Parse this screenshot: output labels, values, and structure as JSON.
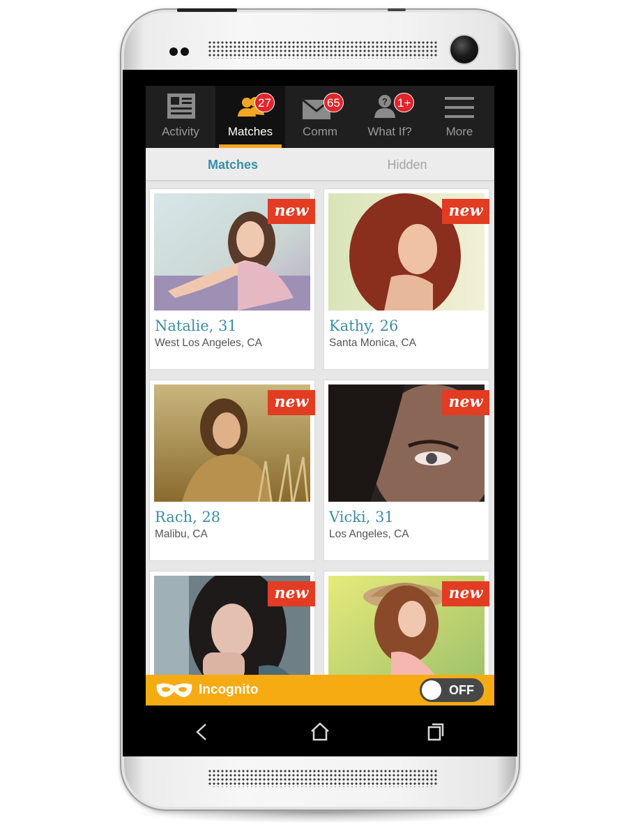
{
  "tabs": [
    {
      "label": "Activity",
      "icon": "newspaper-icon",
      "badge": ""
    },
    {
      "label": "Matches",
      "icon": "people-icon",
      "badge": "27"
    },
    {
      "label": "Comm",
      "icon": "envelope-icon",
      "badge": "65"
    },
    {
      "label": "What If?",
      "icon": "question-person-icon",
      "badge": "1+"
    },
    {
      "label": "More",
      "icon": "menu-icon",
      "badge": ""
    }
  ],
  "subtabs": [
    {
      "label": "Matches"
    },
    {
      "label": "Hidden"
    }
  ],
  "cards": [
    {
      "name": "Natalie, 31",
      "location": "West Los Angeles, CA",
      "tag": "new"
    },
    {
      "name": "Kathy, 26",
      "location": "Santa Monica, CA",
      "tag": "new"
    },
    {
      "name": "Rach, 28",
      "location": "Malibu, CA",
      "tag": "new"
    },
    {
      "name": "Vicki, 31",
      "location": "Los Angeles, CA",
      "tag": "new"
    },
    {
      "name": "",
      "location": "",
      "tag": "new"
    },
    {
      "name": "",
      "location": "",
      "tag": "new"
    }
  ],
  "incognito": {
    "label": "Incognito",
    "toggle": "OFF"
  },
  "colors": {
    "accent": "#f5a623",
    "badge": "#e0262b",
    "new_tag": "#e23c22",
    "name_text": "#3a8ea5",
    "incognito_bar": "#f6ab12"
  }
}
